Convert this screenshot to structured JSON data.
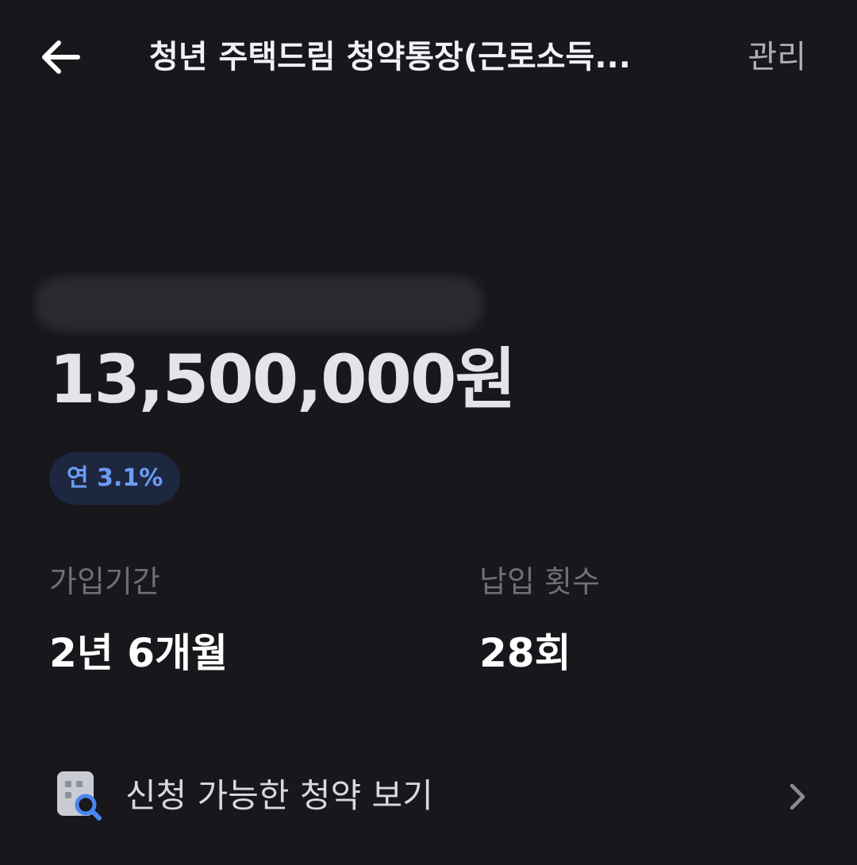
{
  "header": {
    "title": "청년 주택드림 청약통장(근로소득...",
    "manage_label": "관리"
  },
  "account": {
    "balance": "13,500,000원",
    "rate_badge": "연 3.1%"
  },
  "stats": {
    "period_label": "가입기간",
    "period_value": "2년 6개월",
    "count_label": "납입 횟수",
    "count_value": "28회"
  },
  "list": {
    "view_subscriptions_label": "신청 가능한 청약 보기"
  },
  "icons": {
    "back": "arrow-left-icon",
    "building_search": "building-search-icon",
    "chevron": "chevron-right-icon"
  },
  "colors": {
    "background": "#17171c",
    "accent": "#6b9cf5",
    "badge_bg": "#1e2740",
    "muted_text": "#6f6f77"
  }
}
